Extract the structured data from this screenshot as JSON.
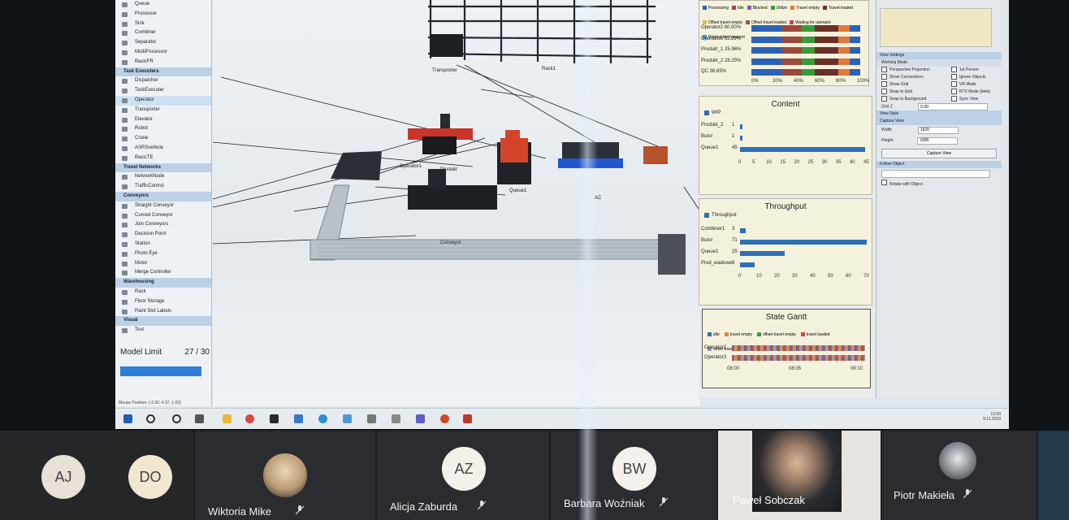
{
  "library": {
    "items": [
      {
        "label": "Queue",
        "type": "item"
      },
      {
        "label": "Processor",
        "type": "item"
      },
      {
        "label": "Sink",
        "type": "item"
      },
      {
        "label": "Combiner",
        "type": "item"
      },
      {
        "label": "Separator",
        "type": "item"
      },
      {
        "label": "MultiProcessor",
        "type": "item"
      },
      {
        "label": "BasicFR",
        "type": "item"
      },
      {
        "label": "Task Executers",
        "type": "cat"
      },
      {
        "label": "Dispatcher",
        "type": "item"
      },
      {
        "label": "TaskExecuter",
        "type": "item"
      },
      {
        "label": "Operator",
        "type": "sel"
      },
      {
        "label": "Transporter",
        "type": "item"
      },
      {
        "label": "Elevator",
        "type": "item"
      },
      {
        "label": "Robot",
        "type": "item"
      },
      {
        "label": "Crane",
        "type": "item"
      },
      {
        "label": "ASRSvehicle",
        "type": "item"
      },
      {
        "label": "BasicTE",
        "type": "item"
      },
      {
        "label": "Travel Networks",
        "type": "cat"
      },
      {
        "label": "NetworkNode",
        "type": "item"
      },
      {
        "label": "TrafficControl",
        "type": "item"
      },
      {
        "label": "Conveyors",
        "type": "cat"
      },
      {
        "label": "Straight Conveyor",
        "type": "item"
      },
      {
        "label": "Curved Conveyor",
        "type": "item"
      },
      {
        "label": "Join Conveyors",
        "type": "item"
      },
      {
        "label": "Decision Point",
        "type": "item"
      },
      {
        "label": "Station",
        "type": "item"
      },
      {
        "label": "Photo Eye",
        "type": "item"
      },
      {
        "label": "Motor",
        "type": "item"
      },
      {
        "label": "Merge Controller",
        "type": "item"
      },
      {
        "label": "Warehousing",
        "type": "cat"
      },
      {
        "label": "Rack",
        "type": "item"
      },
      {
        "label": "Floor Storage",
        "type": "item"
      },
      {
        "label": "Paint Slot Labels",
        "type": "item"
      },
      {
        "label": "Visual",
        "type": "cat"
      },
      {
        "label": "Text",
        "type": "item"
      }
    ],
    "model_limit_label": "Model Limit",
    "model_limit_value": "27 / 30",
    "status": "Mouse Position: (-2.92, 4.37, 1.03)"
  },
  "scene": {
    "labels": {
      "rack": "Rack1",
      "transporter": "Transporter",
      "operator": "Operator1",
      "produkt": "Produkt",
      "queue": "Queue1",
      "ac": "AC",
      "conveyor": "Conveyor"
    }
  },
  "dashboard": {
    "state_chart": {
      "legend": [
        {
          "label": "Processing",
          "color": "#2b62b8"
        },
        {
          "label": "Idle",
          "color": "#9a4a3a"
        },
        {
          "label": "Blocked",
          "color": "#8f54a8"
        },
        {
          "label": "Utilize",
          "color": "#3a9a3a"
        },
        {
          "label": "Travel empty",
          "color": "#e07a3a"
        },
        {
          "label": "Travel loaded",
          "color": "#6b2f2a"
        },
        {
          "label": "Offset travel empty",
          "color": "#e0c040"
        },
        {
          "label": "Offset travel loaded",
          "color": "#a35a2a"
        },
        {
          "label": "Waiting for operator",
          "color": "#d04060"
        },
        {
          "label": "Waiting for transport",
          "color": "#3fa0d0"
        }
      ],
      "rows": [
        {
          "label": "Operator2",
          "pct": "60.00%"
        },
        {
          "label": "Operator3",
          "pct": "55.29%"
        },
        {
          "label": "Produkt_1",
          "pct": "25.96%"
        },
        {
          "label": "Produkt_2",
          "pct": "28.25%"
        },
        {
          "label": "QC",
          "pct": "36.65%"
        }
      ],
      "ticks": [
        "0%",
        "20%",
        "40%",
        "60%",
        "80%",
        "100%"
      ]
    },
    "content": {
      "title": "Content",
      "legend": "WIP",
      "rows": [
        {
          "label": "Produkt_2",
          "value": 1
        },
        {
          "label": "Butor",
          "value": 1
        },
        {
          "label": "Queue1",
          "value": 45
        }
      ],
      "ticks": [
        "0",
        "5",
        "10",
        "15",
        "20",
        "25",
        "30",
        "35",
        "40",
        "45"
      ]
    },
    "throughput": {
      "title": "Throughput",
      "legend": "Throughput",
      "rows": [
        {
          "label": "Combiner1",
          "value": 3
        },
        {
          "label": "Butor",
          "value": 71
        },
        {
          "label": "Queue1",
          "value": 25
        },
        {
          "label": "Prod_wadowe",
          "value": 8
        }
      ],
      "ticks": [
        "0",
        "10",
        "20",
        "30",
        "40",
        "50",
        "60",
        "70"
      ]
    },
    "gantt": {
      "title": "State Gantt",
      "legend": [
        {
          "label": "idle",
          "color": "#2f6fb5"
        },
        {
          "label": "travel empty",
          "color": "#e0883a"
        },
        {
          "label": "offset travel empty",
          "color": "#3a9a3a"
        },
        {
          "label": "travel loaded",
          "color": "#c0504d"
        },
        {
          "label": "offset travel loaded",
          "color": "#8fa0c8"
        },
        {
          "label": "utilize",
          "color": "#a37a4a"
        }
      ],
      "rows": [
        "Operator2",
        "Operator3"
      ],
      "ticks": [
        "08:00",
        "08:05",
        "08:10"
      ]
    }
  },
  "properties": {
    "sections": {
      "view_settings": "View Settings",
      "working_mode": "Working Mode",
      "view_style": "View Style",
      "capture_view": "Capture View",
      "follow_object": "Follow Object"
    },
    "checks_left": [
      "Perspective Projection",
      "Show Connections",
      "Show Grid",
      "Snap to Grid",
      "Snap to Background"
    ],
    "checks_right": [
      "1st Person",
      "Ignore Objects",
      "VR Mode",
      "RTX Mode (beta)",
      "Sync View"
    ],
    "grid_label": "Grid Z",
    "grid_value": "0.00",
    "width_label": "Width",
    "width_value": "1920",
    "height_label": "Height",
    "height_value": "1080",
    "capture_button": "Capture View",
    "rotate_label": "Rotate with Object"
  },
  "taskbar": {
    "time": "12:00",
    "date": "9.11.2020"
  },
  "meeting": {
    "participants": [
      {
        "initials": "AJ",
        "name": ""
      },
      {
        "initials": "DO",
        "name": ""
      },
      {
        "initials": "",
        "name": "Wiktoria Mike"
      },
      {
        "initials": "AZ",
        "name": "Alicja Zaburda"
      },
      {
        "initials": "BW",
        "name": "Barbara Woźniak"
      },
      {
        "initials": "",
        "name": "Paweł Sobczak"
      },
      {
        "initials": "",
        "name": "Piotr Makieła"
      }
    ]
  }
}
